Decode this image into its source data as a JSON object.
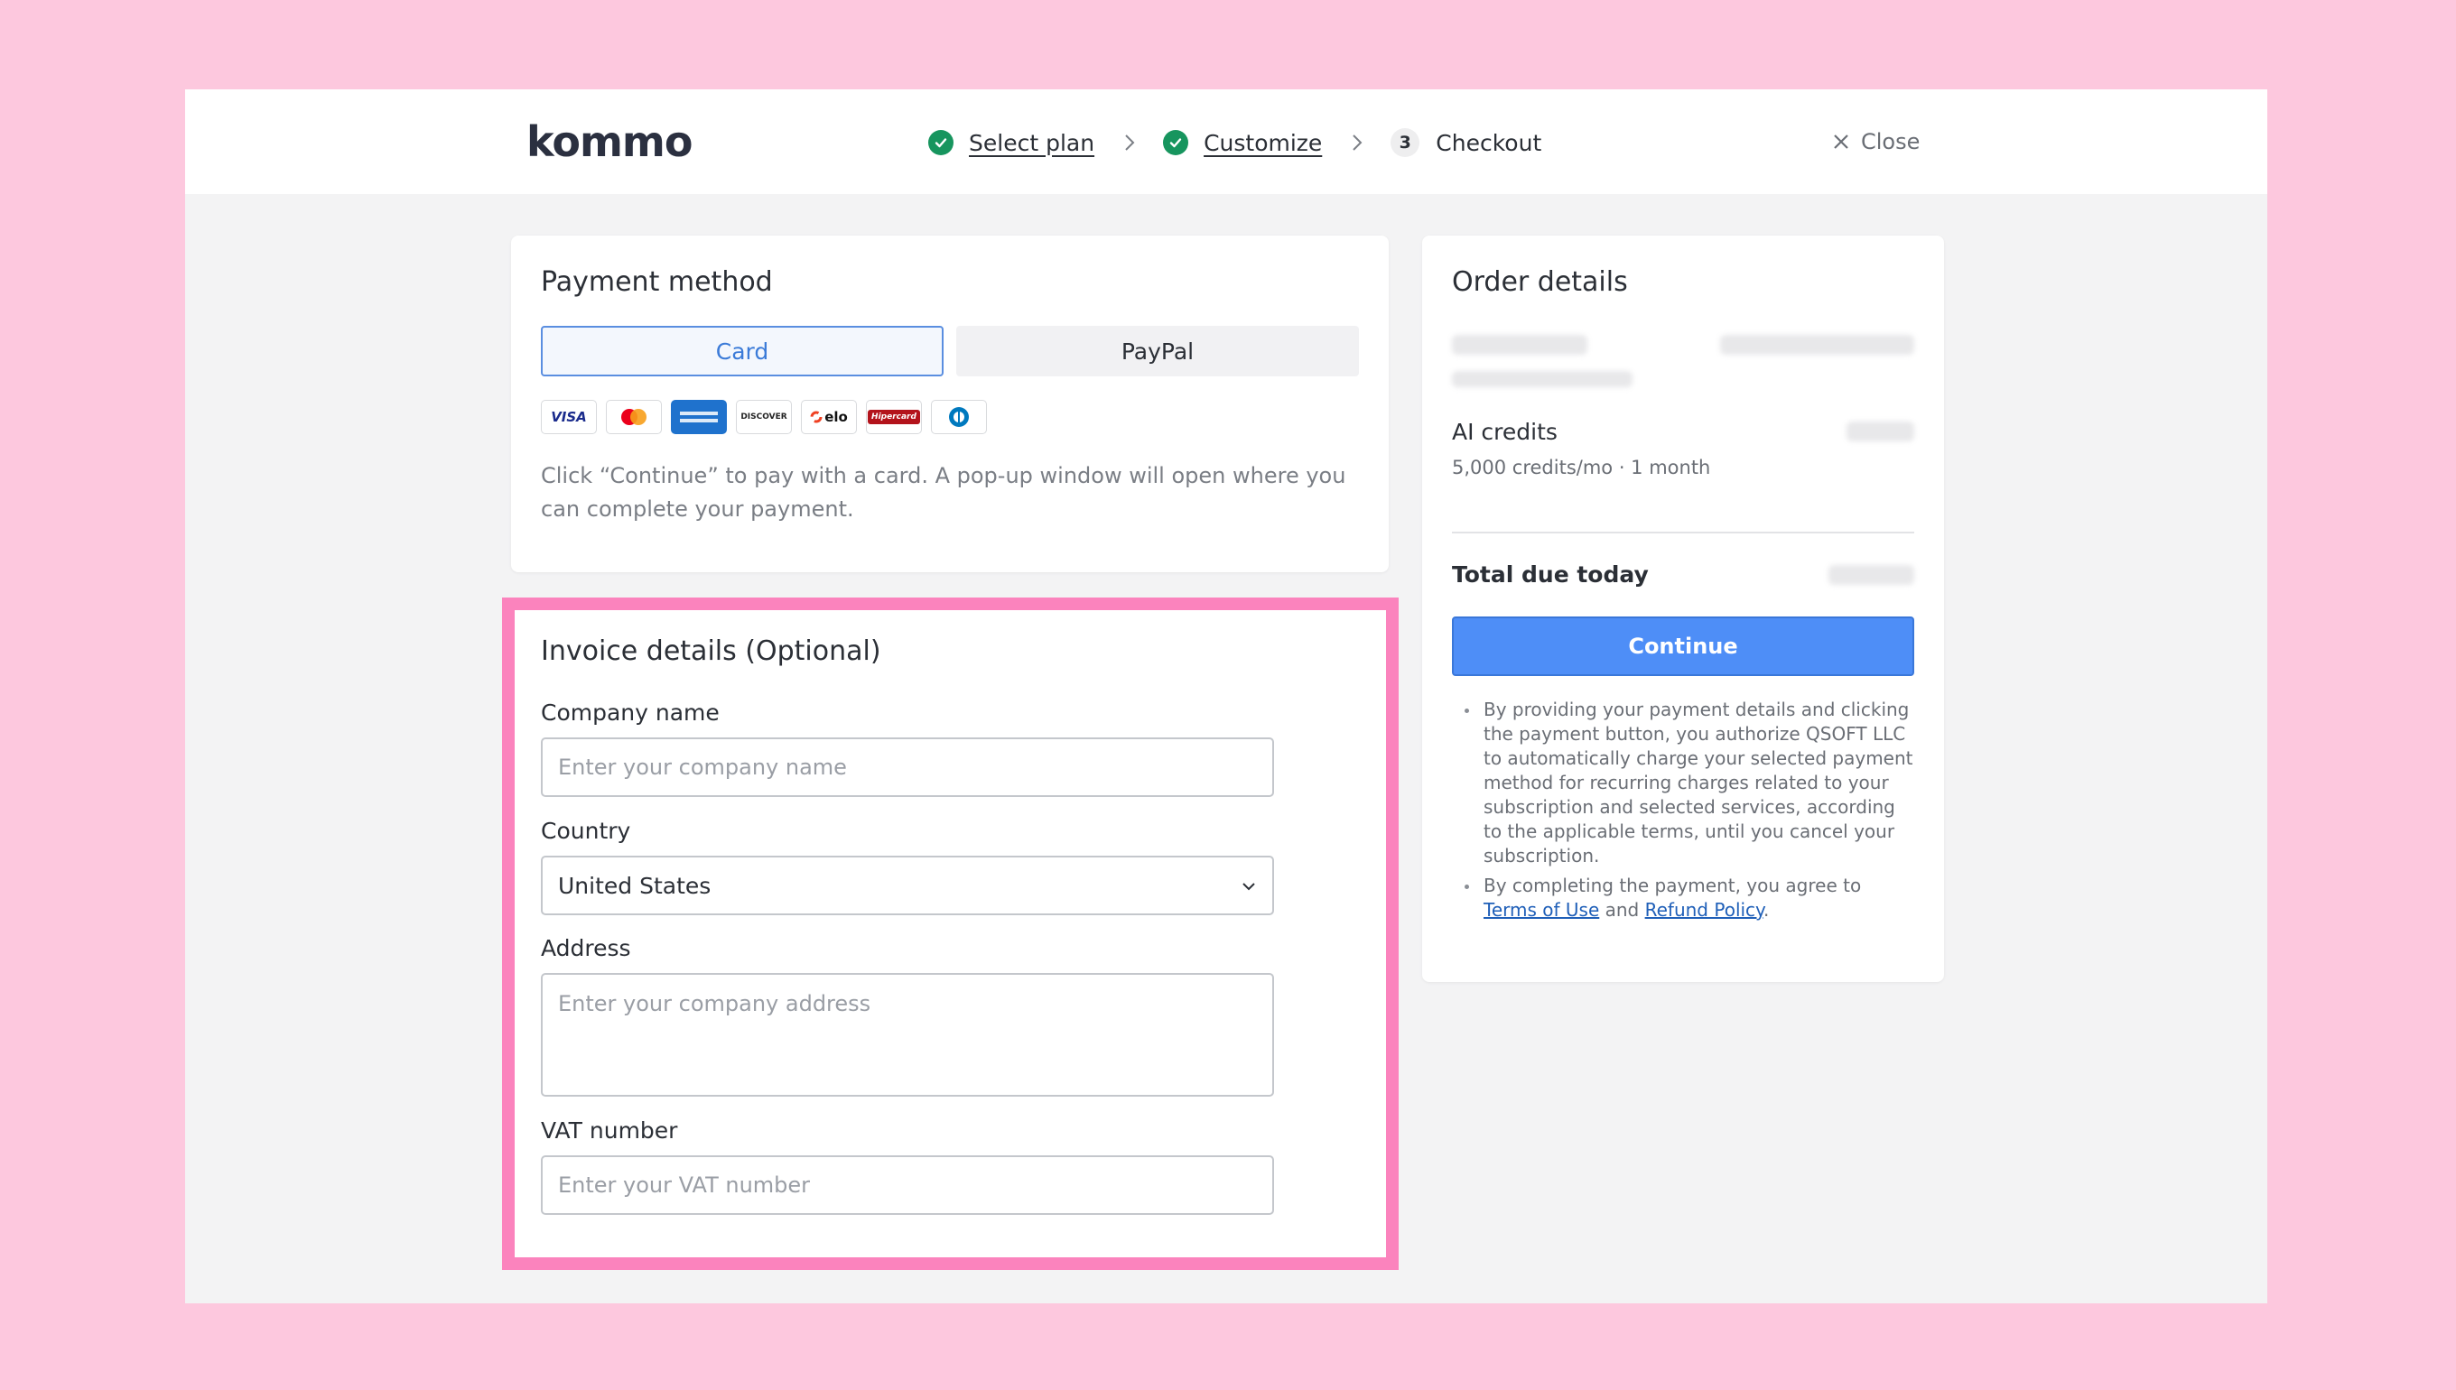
{
  "header": {
    "logo": "kommo",
    "steps": [
      {
        "label": "Select plan",
        "state": "done"
      },
      {
        "label": "Customize",
        "state": "done"
      },
      {
        "label": "Checkout",
        "state": "current",
        "number": "3"
      }
    ],
    "close_label": "Close"
  },
  "payment": {
    "title": "Payment method",
    "tabs": {
      "card": "Card",
      "paypal": "PayPal"
    },
    "selected_tab": "Card",
    "brands": [
      "VISA",
      "Mastercard",
      "American Express",
      "DISCOVER",
      "elo",
      "Hipercard",
      "Diners Club"
    ],
    "brand_text": {
      "visa": "VISA",
      "discover": "DISCOVER",
      "elo": "elo",
      "hipercard": "Hipercard"
    },
    "note": "Click “Continue” to pay with a card. A pop-up window will open where you can complete your payment."
  },
  "invoice": {
    "title": "Invoice details (Optional)",
    "company_label": "Company name",
    "company_placeholder": "Enter your company name",
    "country_label": "Country",
    "country_value": "United States",
    "address_label": "Address",
    "address_placeholder": "Enter your company address",
    "vat_label": "VAT number",
    "vat_placeholder": "Enter your VAT number"
  },
  "order": {
    "title": "Order details",
    "ai_title": "AI credits",
    "ai_sub": "5,000 credits/mo · 1 month",
    "total_label": "Total due today",
    "continue_label": "Continue",
    "terms_1": "By providing your payment details and clicking the payment button, you authorize QSOFT LLC to automatically charge your selected payment method for recurring charges related to your subscription and selected services, according to the applicable terms, until you cancel your subscription.",
    "terms_2_prefix": "By completing the payment, you agree to ",
    "terms_link": "Terms of Use",
    "terms_and": " and ",
    "refund_link": "Refund Policy",
    "terms_end": "."
  },
  "colors": {
    "background": "#fdc8de",
    "highlight": "#fb83bd",
    "primary": "#4e8ef7",
    "check": "#17955e"
  }
}
